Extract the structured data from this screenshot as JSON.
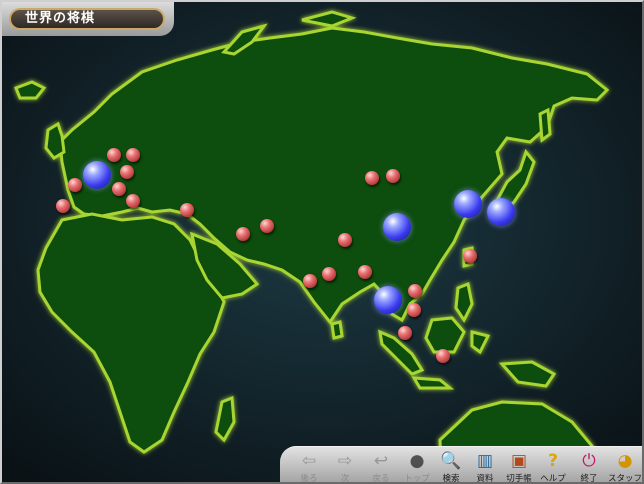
{
  "window": {
    "title": "世界の将棋"
  },
  "map": {
    "sea_color": "#0f1d24",
    "land_color": "#114d0f",
    "land_glow": "#b9e23a",
    "cities_small_count": 25,
    "cities_large_count": 5
  },
  "toolbar": {
    "items": [
      {
        "label": "後ろ",
        "icon": "back-arrow-icon",
        "enabled": false
      },
      {
        "label": "次",
        "icon": "forward-arrow-icon",
        "enabled": false
      },
      {
        "label": "戻る",
        "icon": "return-arrow-icon",
        "enabled": false
      },
      {
        "label": "トップ",
        "icon": "top-ball-icon",
        "enabled": false
      },
      {
        "label": "検索",
        "icon": "magnifier-icon",
        "enabled": true
      },
      {
        "label": "資料",
        "icon": "books-icon",
        "enabled": true
      },
      {
        "label": "切手帳",
        "icon": "stamp-icon",
        "enabled": true
      },
      {
        "label": "ヘルプ",
        "icon": "question-icon",
        "enabled": true
      },
      {
        "label": "終了",
        "icon": "power-icon",
        "enabled": true
      },
      {
        "label": "スタッフ",
        "icon": "staff-icon",
        "enabled": true
      }
    ]
  }
}
